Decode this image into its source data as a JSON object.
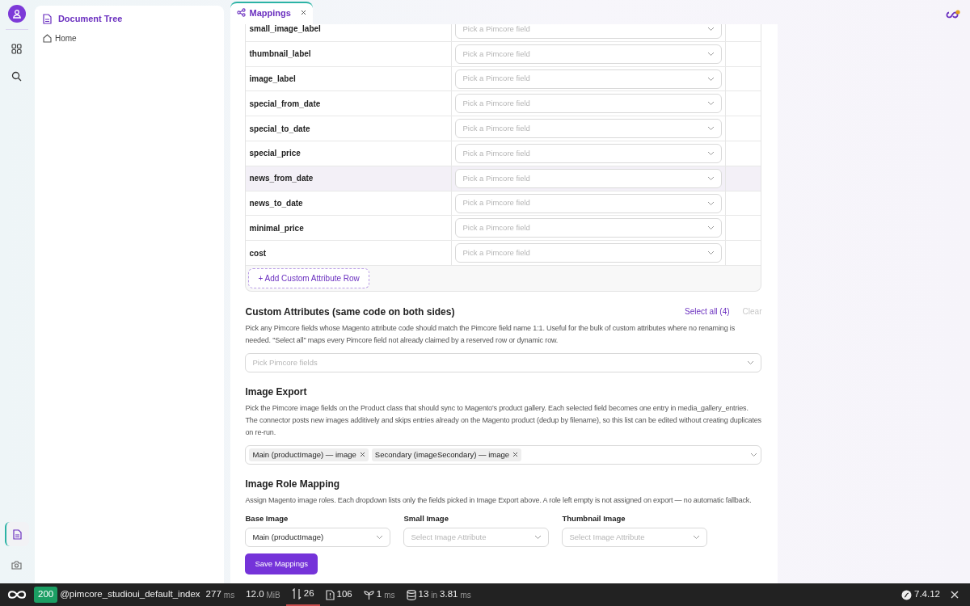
{
  "rail": {
    "items": [
      {
        "kind": "apps",
        "selected": false
      },
      {
        "kind": "search",
        "selected": false
      }
    ],
    "bottom_items": [
      {
        "kind": "documents",
        "selected": true
      },
      {
        "kind": "camera",
        "selected": false
      }
    ]
  },
  "tree": {
    "title": "Document Tree",
    "items": [
      {
        "label": "Home"
      }
    ]
  },
  "tabs": [
    {
      "label": "Mappings",
      "selected": true,
      "closable": true
    }
  ],
  "mapping_table": {
    "rows": [
      {
        "attribute": "small_image_label",
        "placeholder": "Pick a Pimcore field",
        "highlighted": false
      },
      {
        "attribute": "thumbnail_label",
        "placeholder": "Pick a Pimcore field",
        "highlighted": false
      },
      {
        "attribute": "image_label",
        "placeholder": "Pick a Pimcore field",
        "highlighted": false
      },
      {
        "attribute": "special_from_date",
        "placeholder": "Pick a Pimcore field",
        "highlighted": false
      },
      {
        "attribute": "special_to_date",
        "placeholder": "Pick a Pimcore field",
        "highlighted": false
      },
      {
        "attribute": "special_price",
        "placeholder": "Pick a Pimcore field",
        "highlighted": false
      },
      {
        "attribute": "news_from_date",
        "placeholder": "Pick a Pimcore field",
        "highlighted": true
      },
      {
        "attribute": "news_to_date",
        "placeholder": "Pick a Pimcore field",
        "highlighted": false
      },
      {
        "attribute": "minimal_price",
        "placeholder": "Pick a Pimcore field",
        "highlighted": false
      },
      {
        "attribute": "cost",
        "placeholder": "Pick a Pimcore field",
        "highlighted": false
      }
    ],
    "add_button": "+ Add Custom Attribute Row"
  },
  "custom_attributes": {
    "title": "Custom Attributes (same code on both sides)",
    "select_all": {
      "label": "Select all (4)",
      "disabled": false
    },
    "clear": {
      "label": "Clear",
      "disabled": true
    },
    "description": "Pick any Pimcore fields whose Magento attribute code should match the Pimcore field name 1:1. Useful for the bulk of custom attributes where no renaming is needed. \"Select all\" maps every Pimcore field not already claimed by a reserved row or dynamic row.",
    "field": {
      "placeholder": "Pick Pimcore fields"
    }
  },
  "image_export": {
    "title": "Image Export",
    "description": "Pick the Pimcore image fields on the Product class that should sync to Magento's product gallery. Each selected field becomes one entry in media_gallery_entries. The connector posts new images additively and skips entries already on the Magento product (dedup by filename), so this list can be edited without creating duplicates on re-run.",
    "tags": [
      "Main (productImage) — image",
      "Secondary (imageSecondary) — image"
    ]
  },
  "image_roles": {
    "title": "Image Role Mapping",
    "description": "Assign Magento image roles. Each dropdown lists only the fields picked in Image Export above. A role left empty is not assigned on export — no automatic fallback.",
    "roles": [
      {
        "label": "Base Image",
        "value": "Main (productImage)"
      },
      {
        "label": "Small Image",
        "placeholder": "Select Image Attribute"
      },
      {
        "label": "Thumbnail Image",
        "placeholder": "Select Image Attribute"
      }
    ]
  },
  "save_button": "Save Mappings",
  "debug_toolbar": {
    "status": "200",
    "route": "@pimcore_studioui_default_index",
    "time": "277",
    "time_unit": "ms",
    "memory": "12.0",
    "memory_unit": "MiB",
    "requests": "26",
    "requests_highlighted": true,
    "files": "106",
    "events": "1",
    "events_unit": "ms",
    "queries": "13",
    "queries_in": "in",
    "queries_time": "3.81",
    "queries_unit": "ms",
    "version": "7.4.12"
  }
}
